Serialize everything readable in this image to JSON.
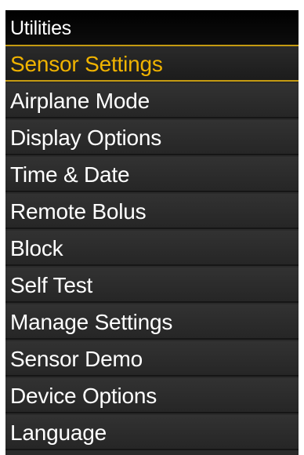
{
  "header": {
    "title": "Utilities"
  },
  "menu": {
    "selected_index": 0,
    "items": [
      {
        "label": "Sensor Settings"
      },
      {
        "label": "Airplane Mode"
      },
      {
        "label": "Display Options"
      },
      {
        "label": "Time & Date"
      },
      {
        "label": "Remote Bolus"
      },
      {
        "label": "Block"
      },
      {
        "label": "Self Test"
      },
      {
        "label": "Manage Settings"
      },
      {
        "label": "Sensor Demo"
      },
      {
        "label": "Device Options"
      },
      {
        "label": "Language"
      }
    ]
  },
  "colors": {
    "background": "#2a2a2a",
    "title_bar": "#000000",
    "accent": "#f0b300",
    "text": "#ffffff"
  }
}
